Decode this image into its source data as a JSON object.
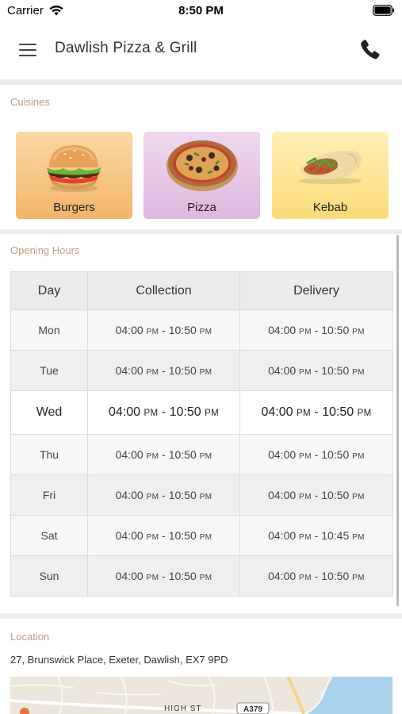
{
  "status_bar": {
    "carrier": "Carrier",
    "time": "8:50 PM",
    "wifi_icon": "wifi-icon",
    "battery_icon": "battery-icon"
  },
  "header": {
    "title": "Dawlish Pizza & Grill",
    "menu_icon": "hamburger-menu-icon",
    "phone_icon": "phone-icon"
  },
  "cuisines": {
    "title": "Cuisines",
    "items": [
      {
        "label": "Burgers",
        "color": "#f6c27f"
      },
      {
        "label": "Pizza",
        "color": "#e2c4e4"
      },
      {
        "label": "Kebab",
        "color": "#fde38e"
      }
    ]
  },
  "opening_hours": {
    "title": "Opening Hours",
    "columns": [
      "Day",
      "Collection",
      "Delivery"
    ],
    "rows": [
      {
        "day": "Mon",
        "collection": {
          "open": "04:00",
          "open_ampm": "PM",
          "close": "10:50",
          "close_ampm": "PM"
        },
        "delivery": {
          "open": "04:00",
          "open_ampm": "PM",
          "close": "10:50",
          "close_ampm": "PM"
        }
      },
      {
        "day": "Tue",
        "collection": {
          "open": "04:00",
          "open_ampm": "PM",
          "close": "10:50",
          "close_ampm": "PM"
        },
        "delivery": {
          "open": "04:00",
          "open_ampm": "PM",
          "close": "10:50",
          "close_ampm": "PM"
        }
      },
      {
        "day": "Wed",
        "collection": {
          "open": "04:00",
          "open_ampm": "PM",
          "close": "10:50",
          "close_ampm": "PM"
        },
        "delivery": {
          "open": "04:00",
          "open_ampm": "PM",
          "close": "10:50",
          "close_ampm": "PM"
        }
      },
      {
        "day": "Thu",
        "collection": {
          "open": "04:00",
          "open_ampm": "PM",
          "close": "10:50",
          "close_ampm": "PM"
        },
        "delivery": {
          "open": "04:00",
          "open_ampm": "PM",
          "close": "10:50",
          "close_ampm": "PM"
        }
      },
      {
        "day": "Fri",
        "collection": {
          "open": "04:00",
          "open_ampm": "PM",
          "close": "10:50",
          "close_ampm": "PM"
        },
        "delivery": {
          "open": "04:00",
          "open_ampm": "PM",
          "close": "10:50",
          "close_ampm": "PM"
        }
      },
      {
        "day": "Sat",
        "collection": {
          "open": "04:00",
          "open_ampm": "PM",
          "close": "10:50",
          "close_ampm": "PM"
        },
        "delivery": {
          "open": "04:00",
          "open_ampm": "PM",
          "close": "10:45",
          "close_ampm": "PM"
        }
      },
      {
        "day": "Sun",
        "collection": {
          "open": "04:00",
          "open_ampm": "PM",
          "close": "10:50",
          "close_ampm": "PM"
        },
        "delivery": {
          "open": "04:00",
          "open_ampm": "PM",
          "close": "10:50",
          "close_ampm": "PM"
        }
      }
    ]
  },
  "location": {
    "title": "Location",
    "address": "27, Brunswick Place, Exeter, Dawlish, EX7 9PD",
    "map_labels": {
      "street": "HIGH ST",
      "road": "A379"
    }
  },
  "colors": {
    "section_title": "#b8a27a",
    "divider": "#ececec"
  }
}
